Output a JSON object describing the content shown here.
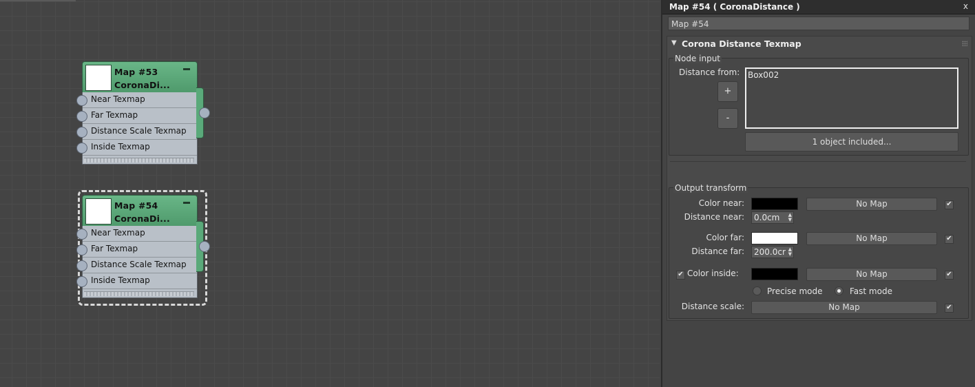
{
  "canvas": {
    "nodes": [
      {
        "name": "Map #53",
        "type": "CoronaDi...",
        "selected": false,
        "slots": [
          "Near Texmap",
          "Far Texmap",
          "Distance Scale Texmap",
          "Inside Texmap"
        ]
      },
      {
        "name": "Map #54",
        "type": "CoronaDi...",
        "selected": true,
        "slots": [
          "Near Texmap",
          "Far Texmap",
          "Distance Scale Texmap",
          "Inside Texmap"
        ]
      }
    ]
  },
  "panel": {
    "title": "Map #54  ( CoronaDistance )",
    "close": "x",
    "name_value": "Map #54",
    "rollout": {
      "arrow": "▼",
      "title": "Corona Distance Texmap"
    },
    "node_input": {
      "label": "Node input",
      "distance_from_label": "Distance from:",
      "add_button": "+",
      "remove_button": "-",
      "objects": [
        "Box002"
      ],
      "included_button": "1 object included..."
    },
    "output_transform": {
      "label": "Output transform",
      "color_near_label": "Color near:",
      "color_near": "#000000",
      "color_near_map": "No Map",
      "color_near_checked": true,
      "distance_near_label": "Distance near:",
      "distance_near": "0.0cm",
      "color_far_label": "Color far:",
      "color_far": "#ffffff",
      "color_far_map": "No Map",
      "color_far_checked": true,
      "distance_far_label": "Distance far:",
      "distance_far": "200.0cr",
      "color_inside_label": "Color inside:",
      "color_inside_enabled": true,
      "color_inside": "#000000",
      "color_inside_map": "No Map",
      "color_inside_checked": true,
      "precise_mode_label": "Precise mode",
      "fast_mode_label": "Fast mode",
      "mode_selected": "fast",
      "distance_scale_label": "Distance scale:",
      "distance_scale_map": "No Map",
      "distance_scale_checked": true
    },
    "check_glyph": "✔",
    "spin_up": "▲",
    "spin_down": "▼"
  }
}
